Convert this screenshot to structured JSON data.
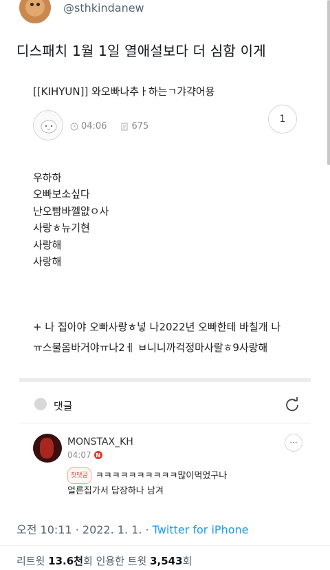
{
  "author": {
    "handle": "@sthkindanew"
  },
  "tweet": {
    "text": "디스패치 1월 1일 열애설보다 더 심함 이게"
  },
  "card": {
    "title": "[[KIHYUN]] 와오빠나추ㅏ하는ㄱ갸갹어용",
    "time": "04:06",
    "views": "675",
    "reply_count": "1",
    "lines": [
      "우하하",
      "오빠보소싶다",
      "난오빰바껠얎ㅇ사",
      "사랑ㅎ뉴기현",
      "사랑해",
      "사랑해"
    ],
    "footer_lines": [
      "+ 나 집아야 오빠사랑ㅎ넣 나2022년 오빠한테 바칠개 나",
      "ㅠ스물옴바거야ㅠ나2ㅔ ㅂ니니까걱정마사랄ㅎ9사랑해"
    ]
  },
  "comments": {
    "label": "댓글",
    "items": [
      {
        "name": "MONSTAX_KH",
        "time": "04:07",
        "badge": "첫댓글",
        "line1": "ㅋㅋㅋㅋㅋㅋㅋㅋㅋㅋ많이먹었구나",
        "line2": "얼른집가서 답장하나 남겨",
        "more": "···"
      }
    ]
  },
  "meta": {
    "timestamp": "오전 10:11 · 2022. 1. 1. · ",
    "source": "Twitter for iPhone"
  },
  "stats": {
    "retweet_label": "리트윗 ",
    "retweet_value": "13.6천",
    "retweet_unit": "회  ",
    "quote_label": "인용한 트윗 ",
    "quote_value": "3,543",
    "quote_unit": "회"
  },
  "colors": {
    "link": "#1d9bf0",
    "secondary": "#536471",
    "badge": "#e03b2e"
  },
  "icons": {
    "clock": "clock-icon",
    "views": "document-icon",
    "bell": "bell-icon",
    "refresh": "refresh-icon"
  }
}
